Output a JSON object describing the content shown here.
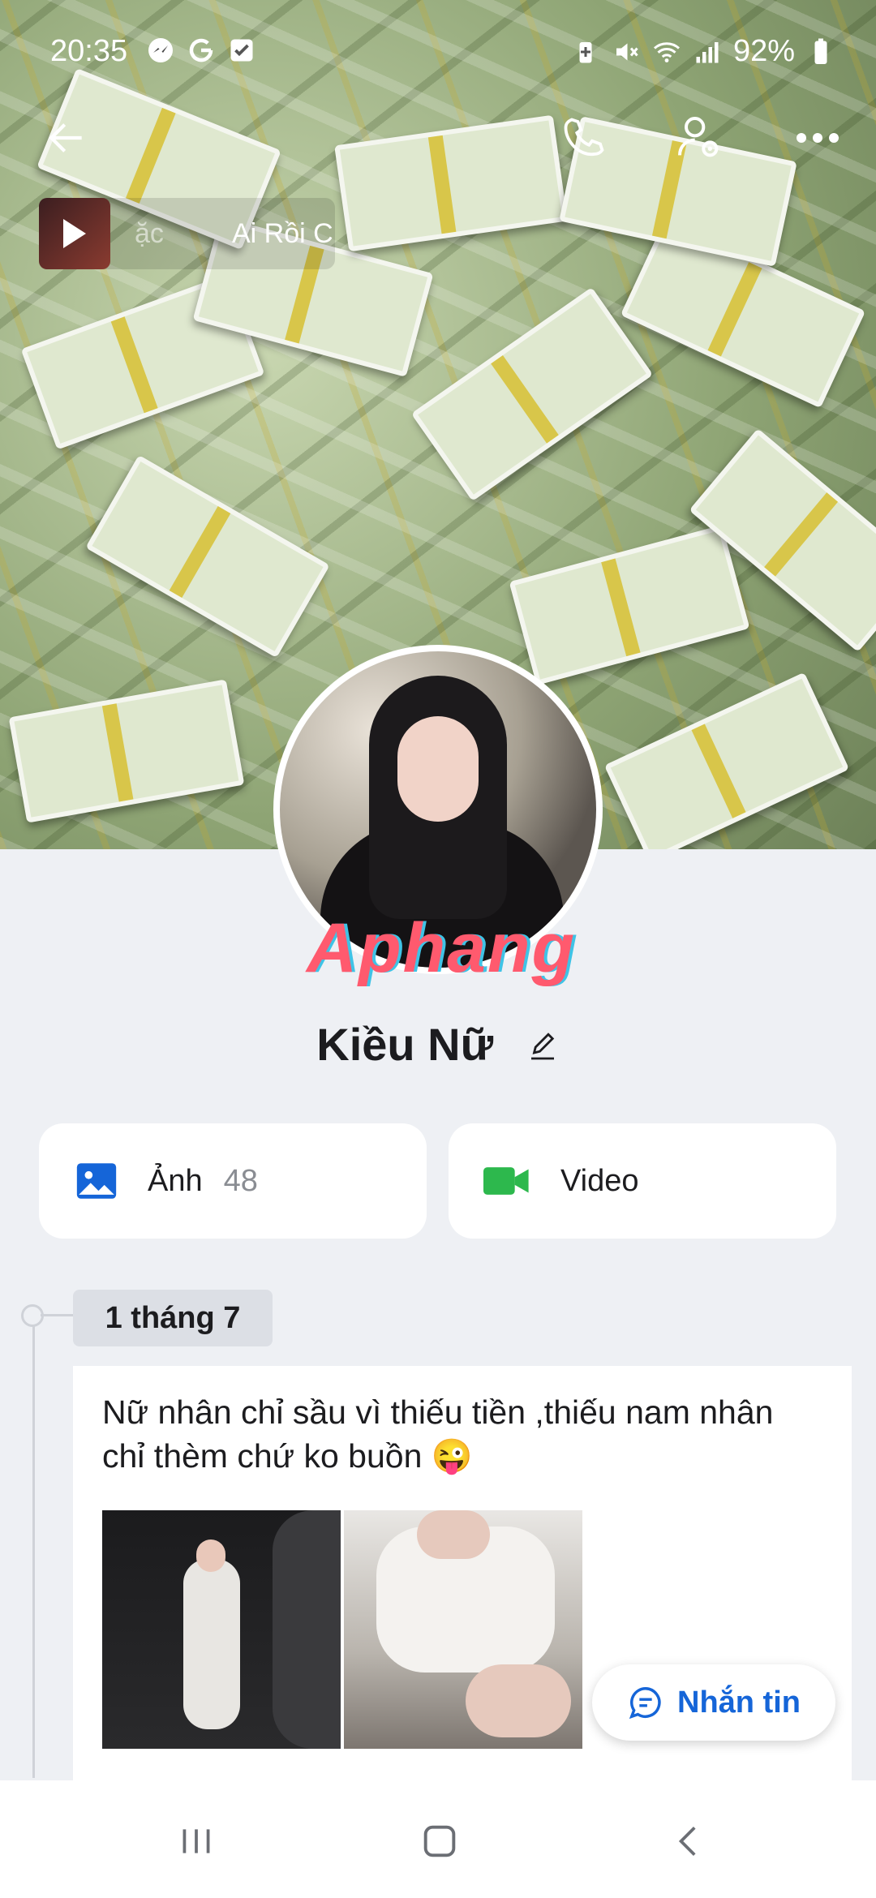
{
  "status_bar": {
    "time": "20:35",
    "battery": "92%",
    "left_icons": [
      "messenger-icon",
      "g-icon",
      "check-square-icon"
    ],
    "right_icons": [
      "battery-saver-icon",
      "mute-icon",
      "wifi-icon",
      "signal-icon",
      "battery-icon"
    ]
  },
  "top_bar": {
    "icons": [
      "back-arrow-icon",
      "phone-icon",
      "user-settings-icon",
      "more-icon"
    ]
  },
  "music": {
    "partial_text": "ặc",
    "song_title": "Ai Rồi C"
  },
  "profile": {
    "watermark": "Aphang",
    "name": "Kiều Nữ"
  },
  "media_cards": {
    "photos_label": "Ảnh",
    "photos_count": "48",
    "video_label": "Video"
  },
  "timeline": {
    "date": "1 tháng 7",
    "post_text": "Nữ nhân chỉ sầu vì thiếu tiền ,thiếu nam nhân chỉ thèm chứ ko buồn 😜"
  },
  "message_button": {
    "label": "Nhắn tin"
  },
  "nav_bar": {
    "icons": [
      "recents-icon",
      "home-icon",
      "back-icon"
    ]
  },
  "colors": {
    "accent": "#1565d8",
    "video_green": "#2db84d",
    "background": "#eef0f4"
  }
}
